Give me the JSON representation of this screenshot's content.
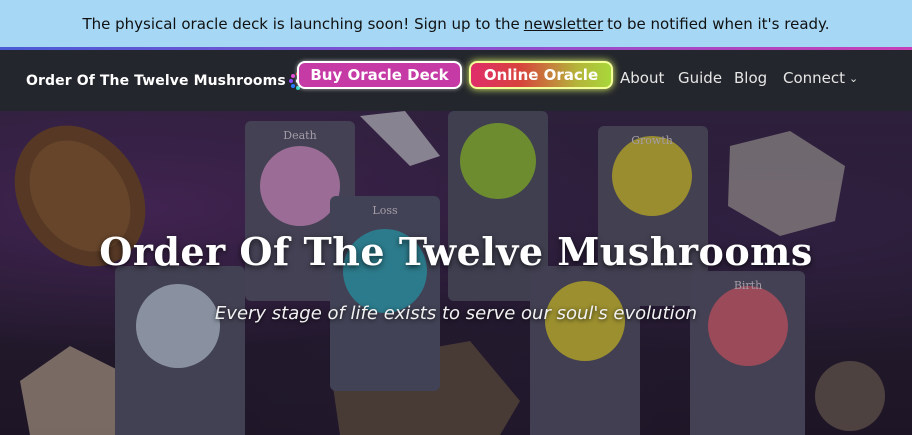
{
  "announcement": {
    "text_before": "The physical oracle deck is launching soon! Sign up to the",
    "link": "newsletter",
    "text_after": "to be notified when it's ready."
  },
  "nav": {
    "brand": "Order Of The Twelve Mushrooms",
    "buy_button": "Buy Oracle Deck",
    "online_button": "Online Oracle",
    "links": [
      "About",
      "Guide",
      "Blog",
      "Connect"
    ]
  },
  "hero": {
    "title": "Order Of The Twelve Mushrooms",
    "subtitle": "Every stage of life exists to serve our soul's evolution",
    "card_labels": [
      "Death",
      "Loss",
      "Growth",
      "Birth"
    ]
  },
  "colors": {
    "announcement_bg": "#a6d8f5",
    "nav_bg": "#23262c",
    "buy_button": "#c63aa6",
    "online_gradient_start": "#e02d6b",
    "online_gradient_end": "#a8d83a"
  }
}
